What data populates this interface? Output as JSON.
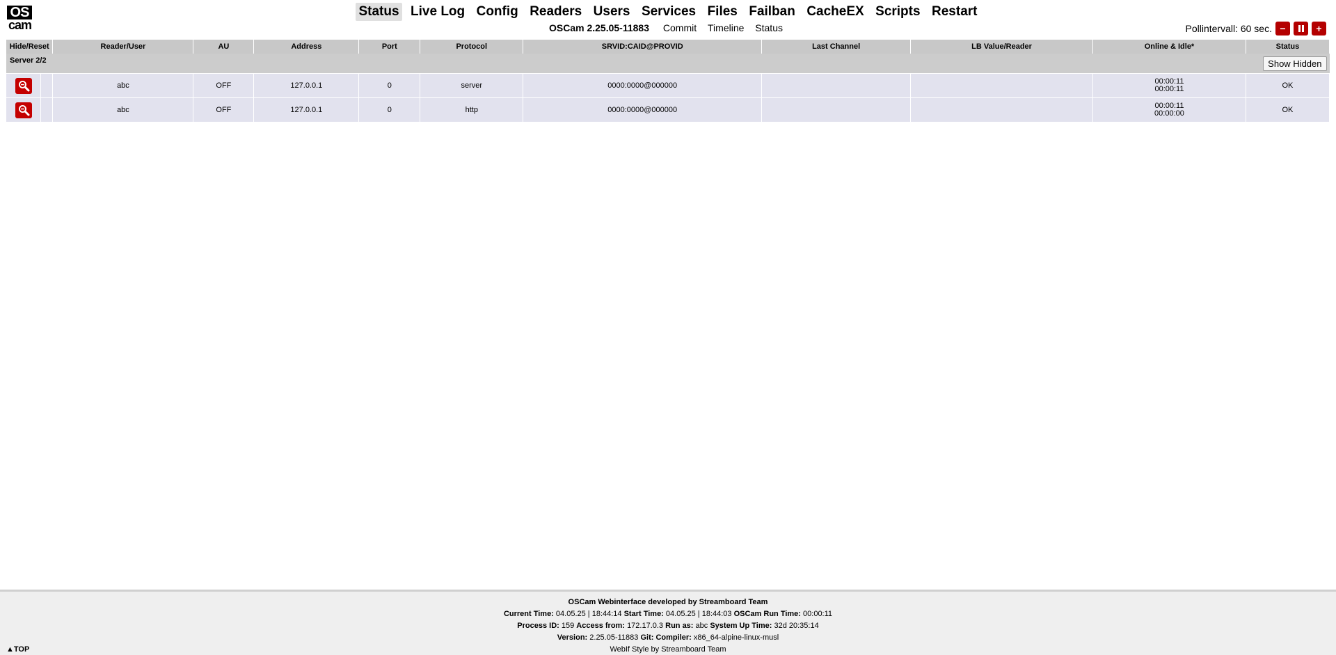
{
  "logo": {
    "top": "OS",
    "bottom": "cam"
  },
  "menu": {
    "items": [
      "Status",
      "Live Log",
      "Config",
      "Readers",
      "Users",
      "Services",
      "Files",
      "Failban",
      "CacheEX",
      "Scripts",
      "Restart"
    ],
    "active": "Status"
  },
  "submenu": {
    "version": "OSCam 2.25.05-11883",
    "links": [
      "Commit",
      "Timeline",
      "Status"
    ]
  },
  "poll": {
    "label": "Pollintervall: 60 sec.",
    "minus": "−",
    "plus": "+"
  },
  "table": {
    "headers": [
      "Hide/Reset",
      "Reader/User",
      "AU",
      "Address",
      "Port",
      "Protocol",
      "SRVID:CAID@PROVID",
      "Last Channel",
      "LB Value/Reader",
      "Online & Idle*",
      "Status"
    ],
    "group_label": "Server 2/2",
    "show_hidden": "Show Hidden",
    "rows": [
      {
        "reader": "abc",
        "au": "OFF",
        "address": "127.0.0.1",
        "port": "0",
        "protocol": "server",
        "srvid": "0000:0000@000000",
        "last_channel": "",
        "lb": "",
        "online": "00:00:11",
        "idle": "00:00:11",
        "status": "OK"
      },
      {
        "reader": "abc",
        "au": "OFF",
        "address": "127.0.0.1",
        "port": "0",
        "protocol": "http",
        "srvid": "0000:0000@000000",
        "last_channel": "",
        "lb": "",
        "online": "00:00:11",
        "idle": "00:00:00",
        "status": "OK"
      }
    ]
  },
  "footer": {
    "credit": "OSCam Webinterface developed by Streamboard Team",
    "current_time_label": "Current Time:",
    "current_time": "04.05.25 | 18:44:14",
    "start_time_label": "Start Time:",
    "start_time": "04.05.25 | 18:44:03",
    "run_time_label": "OSCam Run Time:",
    "run_time": "00:00:11",
    "pid_label": "Process ID:",
    "pid": "159",
    "access_label": "Access from:",
    "access": "172.17.0.3",
    "runas_label": "Run as:",
    "runas": "abc",
    "uptime_label": "System Up Time:",
    "uptime": "32d 20:35:14",
    "version_label": "Version:",
    "version": "2.25.05-11883",
    "git_label": "Git:",
    "compiler_label": "Compiler:",
    "compiler": "x86_64-alpine-linux-musl",
    "style": "WebIf Style by Streamboard Team",
    "top_link": "▲TOP"
  }
}
